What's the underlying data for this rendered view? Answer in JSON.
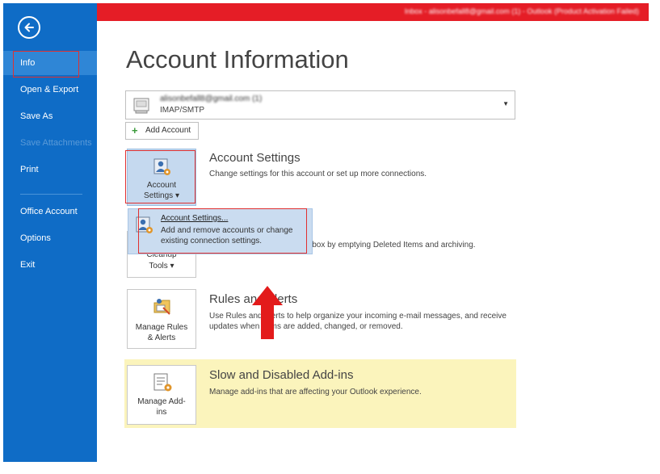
{
  "window": {
    "title_bar_text": "Inbox - alisonbefall8@gmail.com (1) - Outlook (Product Activation Failed)"
  },
  "sidebar": {
    "items": [
      {
        "label": "Info"
      },
      {
        "label": "Open & Export"
      },
      {
        "label": "Save As"
      },
      {
        "label": "Save Attachments"
      },
      {
        "label": "Print"
      },
      {
        "label": "Office Account"
      },
      {
        "label": "Options"
      },
      {
        "label": "Exit"
      }
    ]
  },
  "main": {
    "title": "Account Information",
    "account": {
      "email": "alisonbefall8@gmail.com (1)",
      "type": "IMAP/SMTP"
    },
    "add_account_label": "Add Account",
    "sections": [
      {
        "button_label_1": "Account",
        "button_label_2": "Settings ▾",
        "title": "Account Settings",
        "description": "Change settings for this account or set up more connections."
      },
      {
        "button_label_1": "Cleanup",
        "button_label_2": "Tools ▾",
        "description_fragment": "lbox by emptying Deleted Items and archiving."
      },
      {
        "button_label_1": "Manage Rules",
        "button_label_2": "& Alerts",
        "title": "Rules and Alerts",
        "description_1": "Use Rules and Alerts to help organize your incoming e-mail messages, and receive",
        "description_2": "updates when items are added, changed, or removed."
      },
      {
        "button_label_1": "Manage Add-",
        "button_label_2": "ins",
        "title": "Slow and Disabled Add-ins",
        "description": "Manage add-ins that are affecting your Outlook experience."
      }
    ]
  },
  "popup": {
    "title": "Account Settings...",
    "description": "Add and remove accounts or change existing connection settings."
  },
  "colors": {
    "sidebar": "#0f6cc6",
    "title_bar": "#e51d26",
    "highlight_band": "#fbf4bc",
    "annotation_red": "#e03030"
  }
}
